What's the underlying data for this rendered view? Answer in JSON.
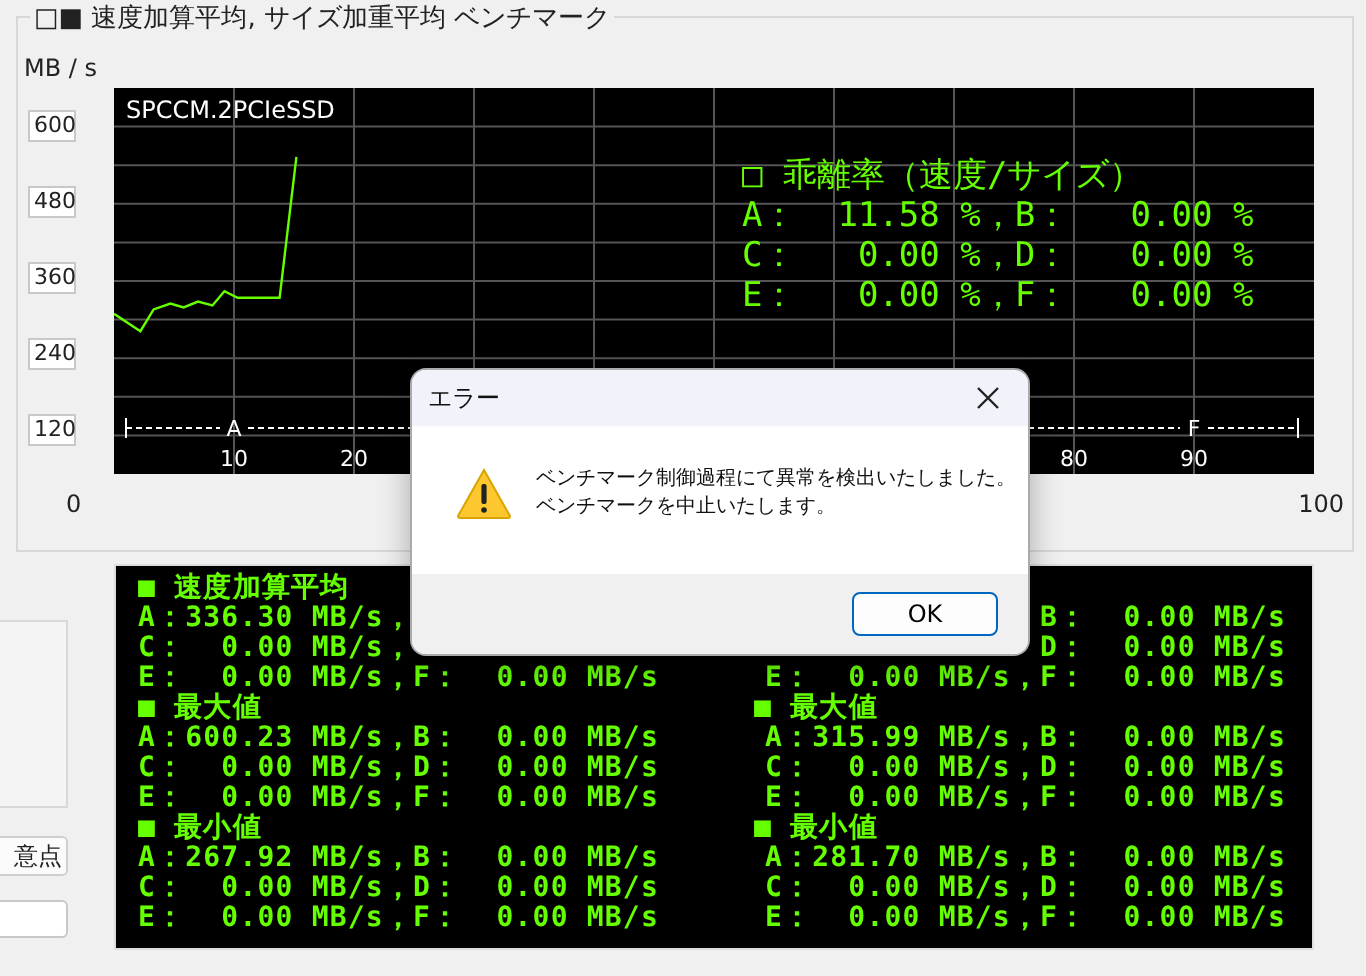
{
  "group_title": "□■ 速度加算平均, サイズ加重平均 ベンチマーク",
  "y_unit": "MB / s",
  "chart": {
    "ruler_labels": [
      "A",
      "F"
    ],
    "chart_data": {
      "type": "line",
      "title": "SPCCM.2PCIeSSD",
      "x": [
        0,
        2.2,
        3.3,
        4.7,
        5.8,
        7,
        8.2,
        9.2,
        10.3,
        13.8,
        15.2
      ],
      "series": [
        {
          "color": "#66ff00",
          "values": [
            309,
            282,
            316,
            325,
            319,
            328,
            322,
            344,
            334,
            334,
            553
          ]
        }
      ],
      "xlim": [
        0,
        100
      ],
      "ylim": [
        60,
        660
      ],
      "xticks": [
        10,
        20,
        80,
        90
      ],
      "yticks": [
        600,
        480,
        360,
        240,
        120
      ],
      "grid": true
    },
    "deviation": {
      "title": "□ 乖離率（速度/サイズ）",
      "lines": [
        "A：  11.58 %，B：   0.00 %",
        "C：   0.00 %，D：   0.00 %",
        "E：   0.00 %，F：   0.00 %"
      ]
    }
  },
  "x_axis_ends": [
    "0",
    "100"
  ],
  "side": {
    "button": "意点"
  },
  "stats": {
    "columns": [
      {
        "blocks": [
          {
            "title": "■ 速度加算平均",
            "lines": [
              "A：336.30 MB/s，",
              "C：  0.00 MB/s，",
              "E：  0.00 MB/s，F：  0.00 MB/s"
            ]
          },
          {
            "title": "■ 最大値",
            "lines": [
              "A：600.23 MB/s，B：  0.00 MB/s",
              "C：  0.00 MB/s，D：  0.00 MB/s",
              "E：  0.00 MB/s，F：  0.00 MB/s"
            ]
          },
          {
            "title": "■ 最小値",
            "lines": [
              "A：267.92 MB/s，B：  0.00 MB/s",
              "C：  0.00 MB/s，D：  0.00 MB/s",
              "E：  0.00 MB/s，F：  0.00 MB/s"
            ]
          }
        ]
      },
      {
        "blocks": [
          {
            "lines": [
              "B：  0.00 MB/s",
              "D：  0.00 MB/s",
              "E：  0.00 MB/s，F：  0.00 MB/s"
            ]
          },
          {
            "title": "■ 最大値",
            "lines": [
              "A：315.99 MB/s，B：  0.00 MB/s",
              "C：  0.00 MB/s，D：  0.00 MB/s",
              "E：  0.00 MB/s，F：  0.00 MB/s"
            ]
          },
          {
            "title": "■ 最小値",
            "lines": [
              "A：281.70 MB/s，B：  0.00 MB/s",
              "C：  0.00 MB/s，D：  0.00 MB/s",
              "E：  0.00 MB/s，F：  0.00 MB/s"
            ]
          }
        ]
      }
    ]
  },
  "dialog": {
    "title": "エラー",
    "message": [
      "ベンチマーク制御過程にて異常を検出いたしました。",
      "ベンチマークを中止いたします。"
    ],
    "button": "OK"
  }
}
